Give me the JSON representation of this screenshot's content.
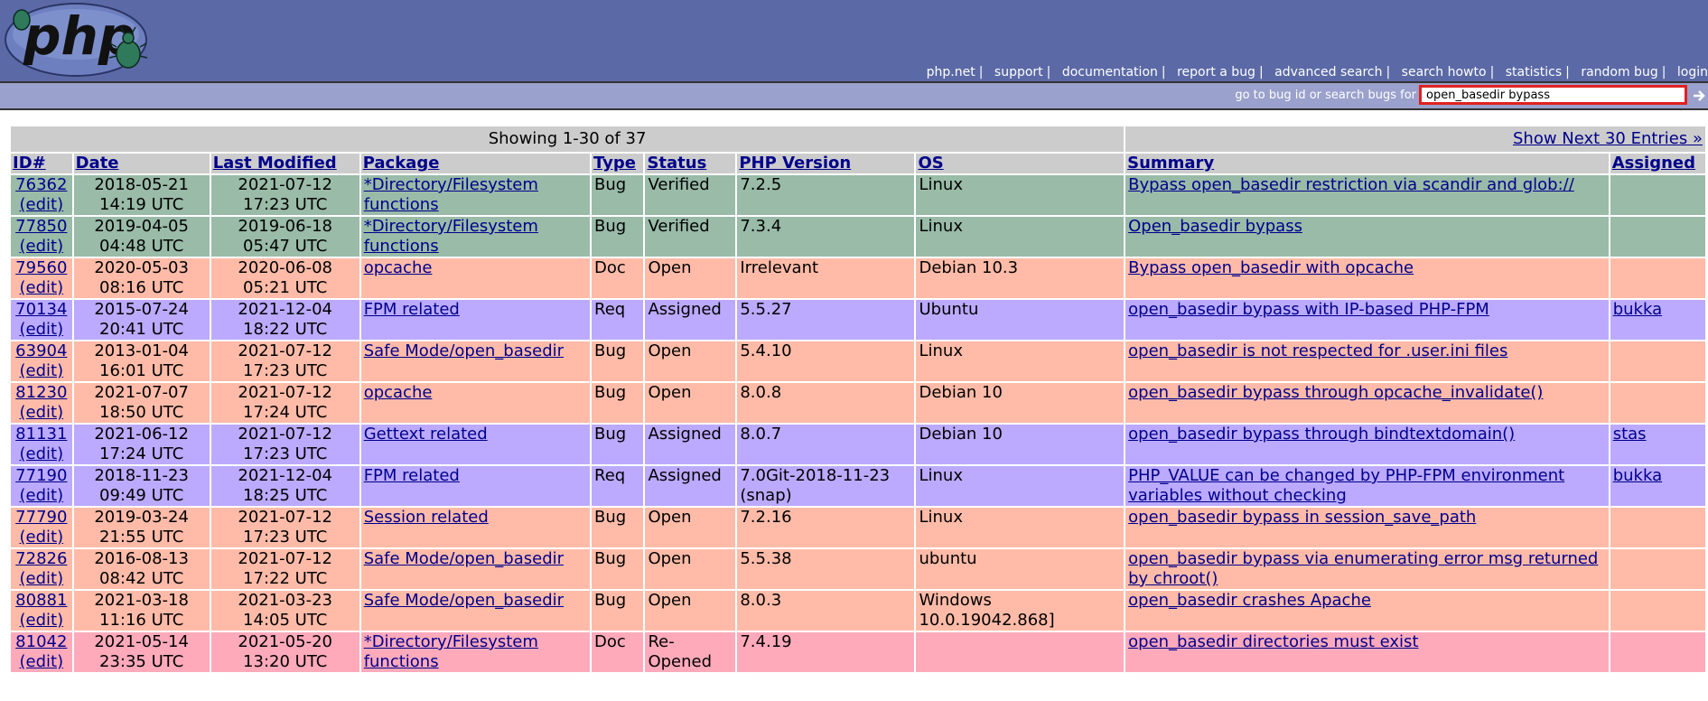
{
  "header": {
    "logo_text": "php",
    "nav": [
      {
        "label": "php.net"
      },
      {
        "label": "support"
      },
      {
        "label": "documentation"
      },
      {
        "label": "report a bug"
      },
      {
        "label": "advanced search"
      },
      {
        "label": "search howto"
      },
      {
        "label": "statistics"
      },
      {
        "label": "random bug"
      },
      {
        "label": "login"
      }
    ]
  },
  "search": {
    "label": "go to bug id or search bugs for",
    "value": "open_basedir bypass",
    "button_icon": "arrow-right-icon"
  },
  "results": {
    "showing": "Showing 1-30 of 37",
    "next_link": "Show Next 30 Entries »",
    "columns": [
      "ID#",
      "Date",
      "Last Modified",
      "Package",
      "Type",
      "Status",
      "PHP Version",
      "OS",
      "Summary",
      "Assigned"
    ],
    "edit_label": "(edit)",
    "rows": [
      {
        "id": "76362",
        "date": "2018-05-21",
        "date_time": "14:19 UTC",
        "mod": "2021-07-12",
        "mod_time": "17:23 UTC",
        "package": "*Directory/Filesystem functions",
        "type": "Bug",
        "status": "Verified",
        "version": "7.2.5",
        "os": "Linux",
        "summary": "Bypass open_basedir restriction via scandir and glob://",
        "assigned": "",
        "color": "#99bba8"
      },
      {
        "id": "77850",
        "date": "2019-04-05",
        "date_time": "04:48 UTC",
        "mod": "2019-06-18",
        "mod_time": "05:47 UTC",
        "package": "*Directory/Filesystem functions",
        "type": "Bug",
        "status": "Verified",
        "version": "7.3.4",
        "os": "Linux",
        "summary": "Open_basedir bypass",
        "assigned": "",
        "color": "#99bba8"
      },
      {
        "id": "79560",
        "date": "2020-05-03",
        "date_time": "08:16 UTC",
        "mod": "2020-06-08",
        "mod_time": "05:21 UTC",
        "package": "opcache",
        "type": "Doc",
        "status": "Open",
        "version": "Irrelevant",
        "os": "Debian 10.3",
        "summary": "Bypass open_basedir with opcache",
        "assigned": "",
        "color": "#ffbba8"
      },
      {
        "id": "70134",
        "date": "2015-07-24",
        "date_time": "20:41 UTC",
        "mod": "2021-12-04",
        "mod_time": "18:22 UTC",
        "package": "FPM related",
        "type": "Req",
        "status": "Assigned",
        "version": "5.5.27",
        "os": "Ubuntu",
        "summary": "open_basedir bypass with IP-based PHP-FPM",
        "assigned": "bukka",
        "color": "#bbaaff"
      },
      {
        "id": "63904",
        "date": "2013-01-04",
        "date_time": "16:01 UTC",
        "mod": "2021-07-12",
        "mod_time": "17:23 UTC",
        "package": "Safe Mode/open_basedir",
        "type": "Bug",
        "status": "Open",
        "version": "5.4.10",
        "os": "Linux",
        "summary": "open_basedir is not respected for .user.ini files",
        "assigned": "",
        "color": "#ffbba8"
      },
      {
        "id": "81230",
        "date": "2021-07-07",
        "date_time": "18:50 UTC",
        "mod": "2021-07-12",
        "mod_time": "17:24 UTC",
        "package": "opcache",
        "type": "Bug",
        "status": "Open",
        "version": "8.0.8",
        "os": "Debian 10",
        "summary": "open_basedir bypass through opcache_invalidate()",
        "assigned": "",
        "color": "#ffbba8"
      },
      {
        "id": "81131",
        "date": "2021-06-12",
        "date_time": "17:24 UTC",
        "mod": "2021-07-12",
        "mod_time": "17:23 UTC",
        "package": "Gettext related",
        "type": "Bug",
        "status": "Assigned",
        "version": "8.0.7",
        "os": "Debian 10",
        "summary": "open_basedir bypass through bindtextdomain()",
        "assigned": "stas",
        "color": "#bbaaff"
      },
      {
        "id": "77190",
        "date": "2018-11-23",
        "date_time": "09:49 UTC",
        "mod": "2021-12-04",
        "mod_time": "18:25 UTC",
        "package": "FPM related",
        "type": "Req",
        "status": "Assigned",
        "version": "7.0Git-2018-11-23 (snap)",
        "os": "Linux",
        "summary": "PHP_VALUE can be changed by PHP-FPM environment variables without checking",
        "assigned": "bukka",
        "color": "#bbaaff"
      },
      {
        "id": "77790",
        "date": "2019-03-24",
        "date_time": "21:55 UTC",
        "mod": "2021-07-12",
        "mod_time": "17:23 UTC",
        "package": "Session related",
        "type": "Bug",
        "status": "Open",
        "version": "7.2.16",
        "os": "Linux",
        "summary": "open_basedir bypass in session_save_path",
        "assigned": "",
        "color": "#ffbba8"
      },
      {
        "id": "72826",
        "date": "2016-08-13",
        "date_time": "08:42 UTC",
        "mod": "2021-07-12",
        "mod_time": "17:22 UTC",
        "package": "Safe Mode/open_basedir",
        "type": "Bug",
        "status": "Open",
        "version": "5.5.38",
        "os": "ubuntu",
        "summary": "open_basedir bypass via enumerating error msg returned by chroot()",
        "assigned": "",
        "color": "#ffbba8"
      },
      {
        "id": "80881",
        "date": "2021-03-18",
        "date_time": "11:16 UTC",
        "mod": "2021-03-23",
        "mod_time": "14:05 UTC",
        "package": "Safe Mode/open_basedir",
        "type": "Bug",
        "status": "Open",
        "version": "8.0.3",
        "os": "Windows 10.0.19042.868]",
        "summary": "open_basedir crashes Apache",
        "assigned": "",
        "color": "#ffbba8"
      },
      {
        "id": "81042",
        "date": "2021-05-14",
        "date_time": "23:35 UTC",
        "mod": "2021-05-20",
        "mod_time": "13:20 UTC",
        "package": "*Directory/Filesystem functions",
        "type": "Doc",
        "status": "Re-Opened",
        "version": "7.4.19",
        "os": "",
        "summary": "open_basedir directories must exist",
        "assigned": "",
        "color": "#ffaabb"
      }
    ]
  }
}
